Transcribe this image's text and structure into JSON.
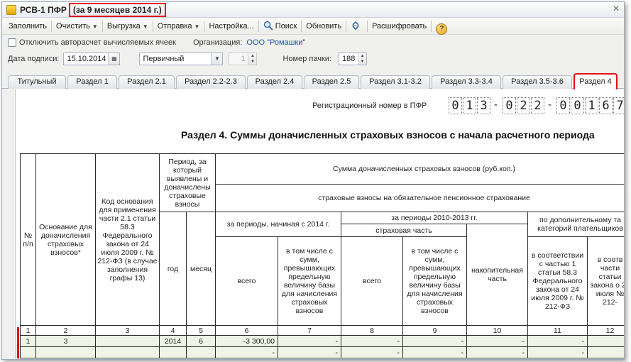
{
  "window": {
    "title": "РСВ-1 ПФР",
    "period": "(за 9 месяцев 2014 г.)"
  },
  "toolbar": {
    "fill": "Заполнить",
    "clear": "Очистить",
    "export": "Выгрузка",
    "send": "Отправка",
    "settings": "Настройка...",
    "search": "Поиск",
    "refresh": "Обновить",
    "decode": "Расшифровать"
  },
  "form": {
    "disable_autocalc": "Отключить авторасчет вычисляемых ячеек",
    "org_label": "Организация:",
    "org_value": "ООО \"Ромашки\"",
    "sign_date_label": "Дата подписи:",
    "sign_date_value": "15.10.2014",
    "doc_type_value": "Первичный",
    "corr_number": "1",
    "pack_label": "Номер пачки:",
    "pack_value": "188"
  },
  "tabs": [
    {
      "label": "Титульный"
    },
    {
      "label": "Раздел 1"
    },
    {
      "label": "Раздел 2.1"
    },
    {
      "label": "Раздел 2.2-2.3"
    },
    {
      "label": "Раздел 2.4"
    },
    {
      "label": "Раздел 2.5"
    },
    {
      "label": "Раздел 3.1-3.2"
    },
    {
      "label": "Раздел 3.3-3.4"
    },
    {
      "label": "Раздел 3.5-3.6"
    },
    {
      "label": "Раздел 4",
      "active": true
    }
  ],
  "report": {
    "reg_label": "Регистрационный номер в ПФР",
    "reg_digits": [
      "0",
      "1",
      "3",
      "-",
      "0",
      "2",
      "2",
      "-",
      "0",
      "0",
      "1",
      "6",
      "7"
    ],
    "section_title": "Раздел 4. Суммы доначисленных страховых взносов с начала расчетного периода",
    "headers": {
      "num": "№ п/п",
      "basis": "Основание для доначисления страховых взносов*",
      "code": "Код основания для применения части 2.1 статьи 58.3 Федерального закона от 24 июля 2009 г. № 212-ФЗ (в случае заполнения графы 13)",
      "period": "Период, за который выявлены и доначислены страховые взносы",
      "year": "год",
      "month": "месяц",
      "sum_total": "Сумма доначисленных страховых взносов (руб.коп.)",
      "pension": "страховые взносы на обязательное пенсионное страхование",
      "from2014": "за периоды, начиная с 2014 г.",
      "total": "всего",
      "exceed": "в том числе с сумм, превышающих предельную величину базы для начисления страховых взносов",
      "p2010": "за периоды 2010-2013 гг.",
      "insurance_part": "страховая часть",
      "total2": "всего",
      "exceed2": "в том числе с сумм, превышающих предельную величину базы для начисления страховых взносов",
      "funded": "накопительная часть",
      "extra": "по дополнительному та категорий плательщиков",
      "art1": "в соответствии с частью 1 статьи 58.3 Федерального закона от 24 июля 2009 г. № 212-ФЗ",
      "art2": "в соотв части статьи закона о 24 июля № 212-"
    },
    "col_numbers": [
      "1",
      "2",
      "3",
      "4",
      "5",
      "6",
      "7",
      "8",
      "9",
      "10",
      "11",
      "12"
    ],
    "rows": [
      [
        "1",
        "3",
        "",
        "2014",
        "6",
        "-3 300,00",
        "-",
        "-",
        "-",
        "-",
        "-",
        "-"
      ],
      [
        "",
        "",
        "",
        "",
        "",
        "-",
        "-",
        "-",
        "-",
        "-",
        "-",
        "-"
      ]
    ]
  },
  "colors": {
    "highlight": "#e01010",
    "row_bg": "#eef5e6",
    "link": "#1a4fb7"
  }
}
